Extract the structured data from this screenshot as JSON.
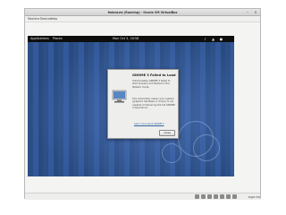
{
  "window": {
    "title": "fedoravm (Running) - Oracle VM VirtualBox",
    "minimize_icon": "minimize-icon",
    "close_icon": "close-icon"
  },
  "menubar": {
    "items": [
      "Machine",
      "Devices",
      "Help"
    ]
  },
  "guest": {
    "topbar": {
      "activities": "Applications",
      "places": "Places",
      "clock": "Mon Oct 3, 18:58",
      "icons": [
        "volume-icon",
        "network-icon",
        "user-icon"
      ]
    },
    "logo_icon": "fedora-logo-icon"
  },
  "dialog": {
    "title": "GNOME 3 Failed to Load",
    "text1": "Unfortunately GNOME 3 failed to start properly and started in the fallback mode.",
    "text2": "This most likely means your system (graphics hardware or driver) is not capable of delivering the full GNOME 3 experience.",
    "link": "Learn more about GNOME 3",
    "close": "Close",
    "illustration_icon": "computer-illustration-icon"
  },
  "statusbar": {
    "host_key": "Right Ctrl",
    "icons": [
      "hdd-icon",
      "cd-icon",
      "usb-icon",
      "network-icon",
      "shared-folder-icon",
      "display-icon",
      "mouse-icon"
    ]
  }
}
